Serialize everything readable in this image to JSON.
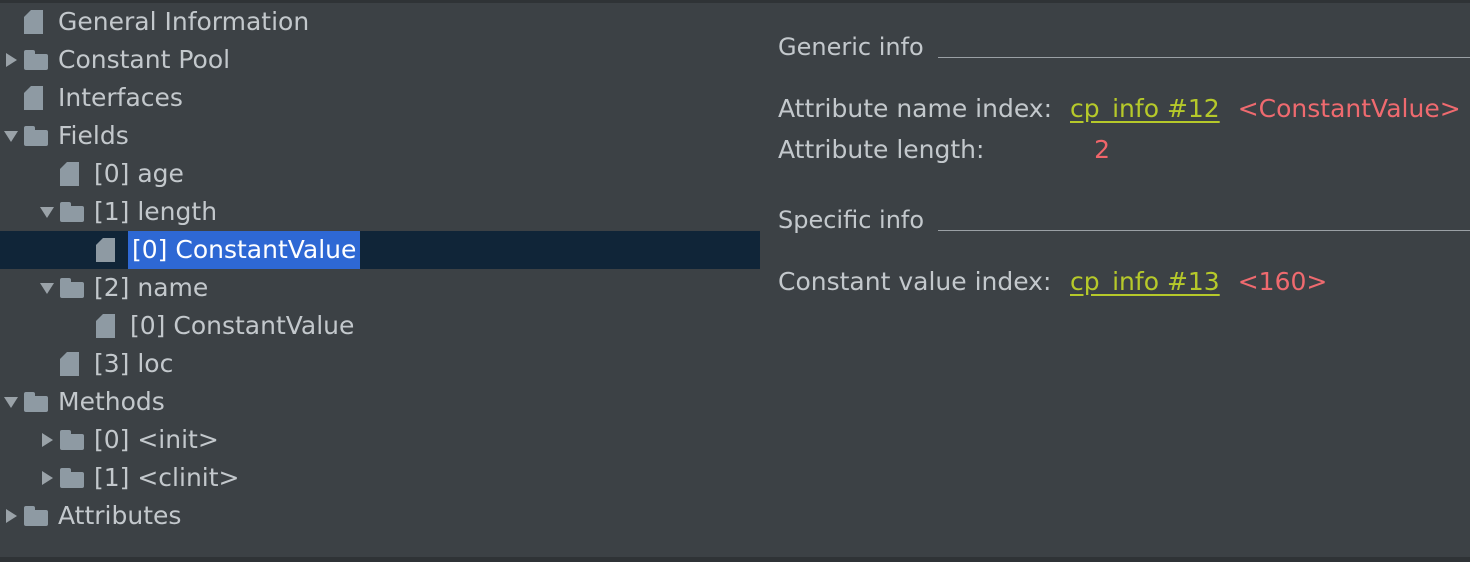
{
  "tree": {
    "name": "class-file-structure-tree",
    "items": [
      {
        "label": "General Information",
        "icon": "file-icon",
        "toggle": "none",
        "depth": 0,
        "selected": false
      },
      {
        "label": "Constant Pool",
        "icon": "folder-icon",
        "toggle": "collapsed",
        "depth": 0,
        "selected": false
      },
      {
        "label": "Interfaces",
        "icon": "file-icon",
        "toggle": "none",
        "depth": 0,
        "selected": false
      },
      {
        "label": "Fields",
        "icon": "folder-icon",
        "toggle": "expanded",
        "depth": 0,
        "selected": false
      },
      {
        "label": "[0] age",
        "icon": "file-icon",
        "toggle": "none",
        "depth": 1,
        "selected": false
      },
      {
        "label": "[1] length",
        "icon": "folder-icon",
        "toggle": "expanded",
        "depth": 1,
        "selected": false
      },
      {
        "label": "[0] ConstantValue",
        "icon": "file-icon",
        "toggle": "none",
        "depth": 2,
        "selected": true
      },
      {
        "label": "[2] name",
        "icon": "folder-icon",
        "toggle": "expanded",
        "depth": 1,
        "selected": false
      },
      {
        "label": "[0] ConstantValue",
        "icon": "file-icon",
        "toggle": "none",
        "depth": 2,
        "selected": false
      },
      {
        "label": "[3] loc",
        "icon": "file-icon",
        "toggle": "none",
        "depth": 1,
        "selected": false
      },
      {
        "label": "Methods",
        "icon": "folder-icon",
        "toggle": "expanded",
        "depth": 0,
        "selected": false
      },
      {
        "label": "[0] <init>",
        "icon": "folder-icon",
        "toggle": "collapsed",
        "depth": 1,
        "selected": false
      },
      {
        "label": "[1] <clinit>",
        "icon": "folder-icon",
        "toggle": "collapsed",
        "depth": 1,
        "selected": false
      },
      {
        "label": "Attributes",
        "icon": "folder-icon",
        "toggle": "collapsed",
        "depth": 0,
        "selected": false
      }
    ]
  },
  "detail": {
    "generic": {
      "title": "Generic info",
      "rows": [
        {
          "key": "Attribute name index:",
          "link": "cp_info #12",
          "extra": "<ConstantValue>",
          "value": null
        },
        {
          "key": "Attribute length:",
          "link": null,
          "extra": null,
          "value": "2"
        }
      ]
    },
    "specific": {
      "title": "Specific info",
      "rows": [
        {
          "key": "Constant value index:",
          "link": "cp_info #13",
          "extra": "<160>",
          "value": null
        }
      ]
    }
  },
  "colors": {
    "background": "#3c4145",
    "selected_row": "#102538",
    "selection_highlight": "#2e68d4",
    "label_text": "#c3c8cc",
    "link": "#b6c92a",
    "value_red": "#ef6a6f",
    "icon": "#8e9aa3"
  }
}
